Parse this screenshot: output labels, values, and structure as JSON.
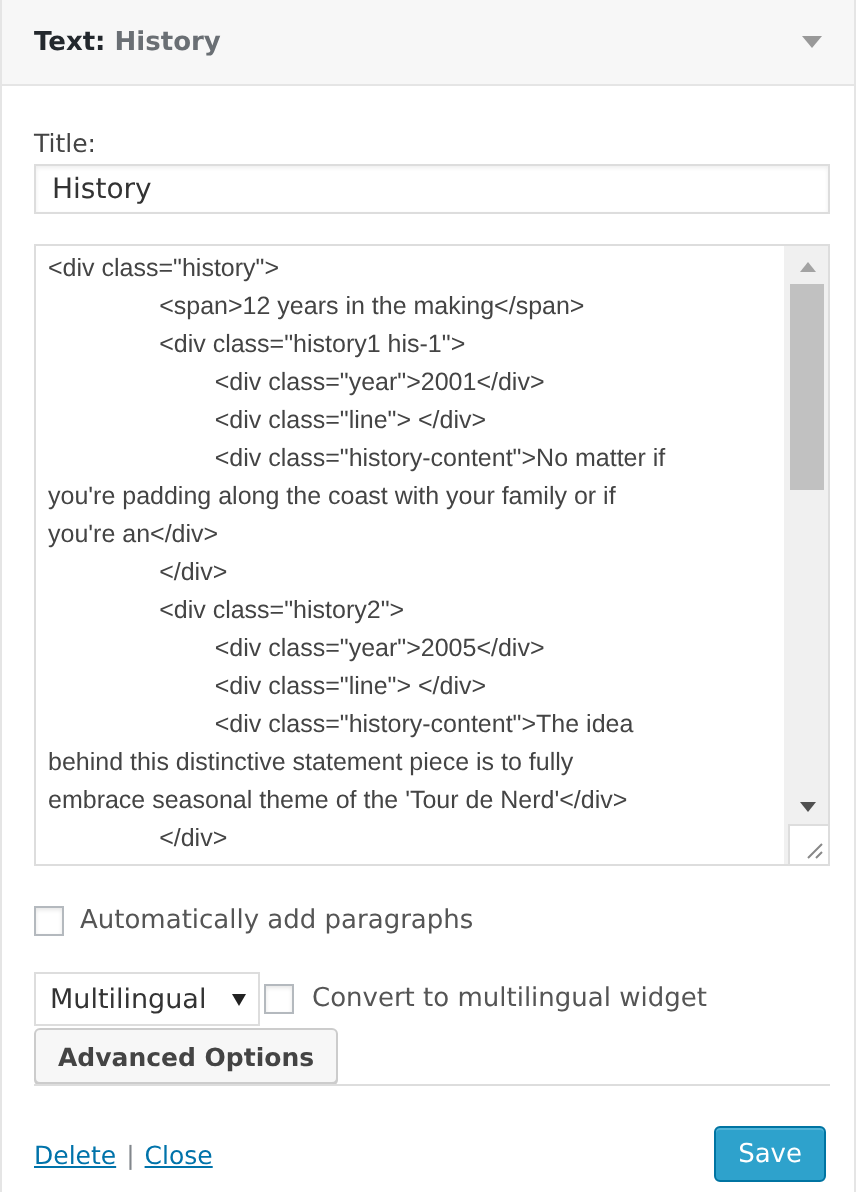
{
  "widget": {
    "type_label": "Text:",
    "title": "History",
    "expanded": true
  },
  "title_field": {
    "label": "Title:",
    "value": "History"
  },
  "content_lines": [
    "<div class=\"history\">",
    "\t\t<span>12 years in the making</span>",
    "\t\t<div class=\"history1 his-1\">",
    "\t\t\t<div class=\"year\">2001</div>",
    "\t\t\t<div class=\"line\"> </div>",
    "\t\t\t<div class=\"history-content\">No matter if",
    "you're padding along the coast with your family or if",
    "you're an</div>",
    "\t\t</div>",
    "\t\t<div class=\"history2\">",
    "\t\t\t<div class=\"year\">2005</div>",
    "\t\t\t<div class=\"line\"> </div>",
    "\t\t\t<div class=\"history-content\">The idea",
    "behind this distinctive statement piece is to fully",
    "embrace seasonal theme of the 'Tour de Nerd'</div>",
    "\t\t</div>"
  ],
  "auto_paragraphs": {
    "label": "Automatically add paragraphs",
    "checked": false
  },
  "language_select": {
    "value": "Multilingual"
  },
  "convert": {
    "label": "Convert to multilingual widget",
    "checked": false
  },
  "advanced_button": "Advanced Options",
  "links": [
    "Delete",
    "Close"
  ],
  "separator": "|",
  "save_button": "Save"
}
